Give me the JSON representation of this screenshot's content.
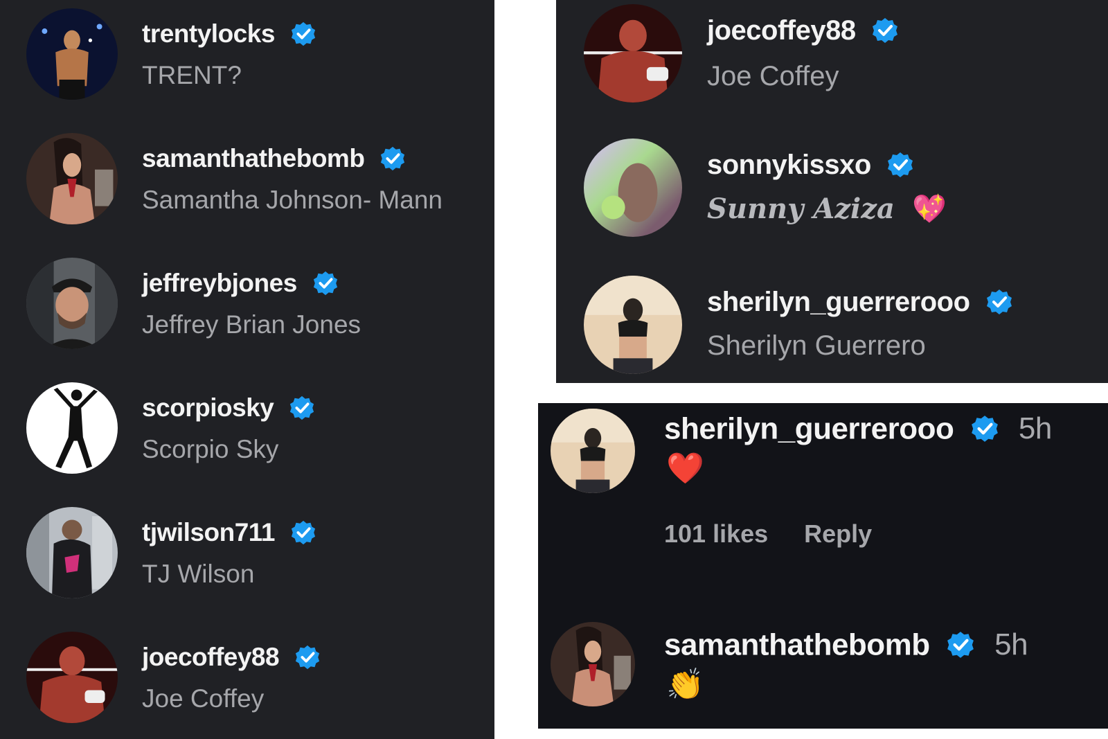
{
  "left_list": [
    {
      "username": "trentylocks",
      "full_name": "TRENT?"
    },
    {
      "username": "samanthathebomb",
      "full_name": "Samantha Johnson- Mann"
    },
    {
      "username": "jeffreybjones",
      "full_name": "Jeffrey Brian Jones"
    },
    {
      "username": "scorpiosky",
      "full_name": "Scorpio Sky"
    },
    {
      "username": "tjwilson711",
      "full_name": "TJ Wilson"
    },
    {
      "username": "joecoffey88",
      "full_name": "Joe Coffey"
    }
  ],
  "right_list": [
    {
      "username": "joecoffey88",
      "full_name": "Joe Coffey"
    },
    {
      "username": "sonnykissxo",
      "full_name": "Sunny Aziza",
      "emoji": "💖"
    },
    {
      "username": "sherilyn_guerrerooo",
      "full_name": "Sherilyn Guerrero"
    }
  ],
  "comments": [
    {
      "username": "sherilyn_guerrerooo",
      "time": "5h",
      "text": "❤️",
      "likes": "101 likes",
      "reply": "Reply"
    },
    {
      "username": "samanthathebomb",
      "time": "5h",
      "text": "👏"
    }
  ],
  "icons": {
    "verified": "verified-badge-icon"
  },
  "colors": {
    "verified": "#1d9bf0",
    "panel_bg": "#202125",
    "comment_bg": "#121318"
  }
}
